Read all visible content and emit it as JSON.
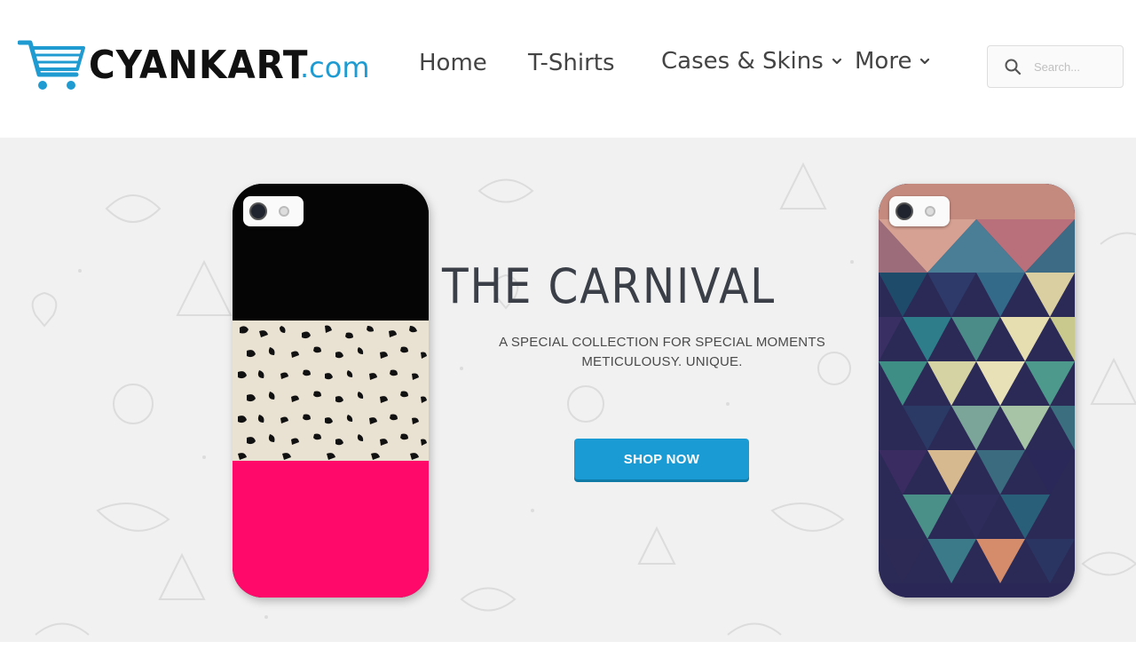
{
  "header": {
    "brand_name": "CYANKART",
    "brand_tld": ".com",
    "cart_icon": "shopping-cart-icon",
    "nav": [
      {
        "label": "Home",
        "has_dropdown": false
      },
      {
        "label": "T-Shirts",
        "has_dropdown": false
      },
      {
        "label": "Cases & Skins",
        "has_dropdown": true
      },
      {
        "label": "More",
        "has_dropdown": true
      }
    ],
    "search": {
      "placeholder": "Search...",
      "icon": "search-icon"
    }
  },
  "hero": {
    "title": "THE CARNIVAL",
    "subtitle_line1": "A SPECIAL COLLECTION FOR SPECIAL MOMENTS",
    "subtitle_line2": "METICULOUSY. UNIQUE.",
    "cta_label": "SHOP NOW",
    "products": [
      {
        "name": "phone-case-black-leopard-pink"
      },
      {
        "name": "phone-case-geometric-triangles"
      }
    ]
  },
  "colors": {
    "brand_blue": "#1b9bd3",
    "hero_background": "#f1f1f1",
    "pink": "#ff0a6a"
  }
}
